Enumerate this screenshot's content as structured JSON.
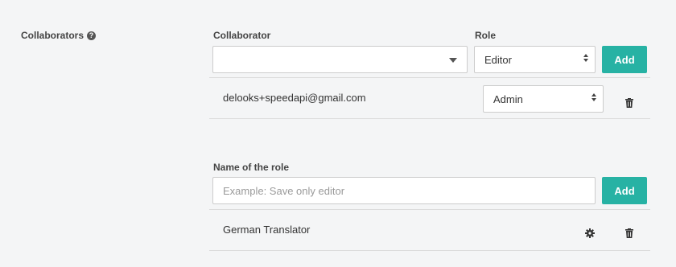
{
  "section": {
    "label": "Collaborators",
    "help_icon": "question-circle-icon",
    "help_glyph": "?"
  },
  "collaborators": {
    "collaborator_label": "Collaborator",
    "collaborator_value": "",
    "role_label": "Role",
    "role_value": "Editor",
    "add_label": "Add",
    "list": [
      {
        "email": "delooks+speedapi@gmail.com",
        "role": "Admin",
        "delete_icon": "trash-icon"
      }
    ]
  },
  "roles": {
    "name_label": "Name of the role",
    "name_placeholder": "Example: Save only editor",
    "add_label": "Add",
    "list": [
      {
        "name": "German Translator",
        "settings_icon": "gear-icon",
        "delete_icon": "trash-icon"
      }
    ]
  },
  "colors": {
    "accent": "#27b2a4",
    "background": "#f4f5f6"
  }
}
